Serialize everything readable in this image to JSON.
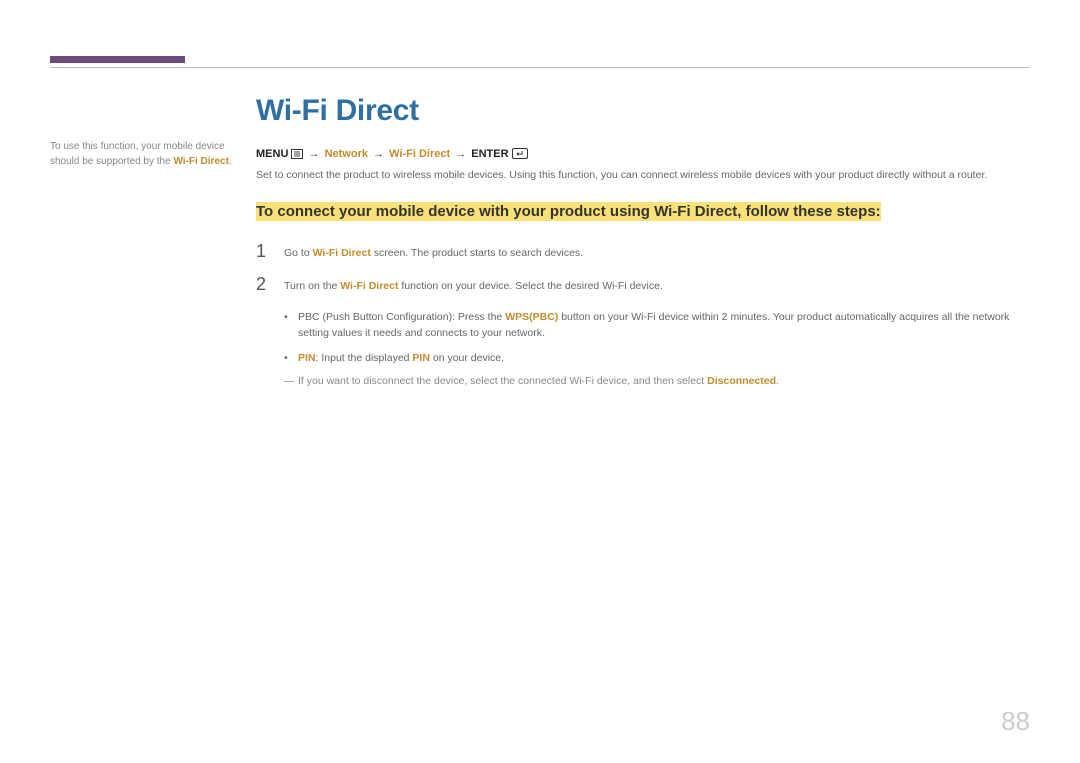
{
  "sidebar": {
    "line1": "To use this function, your mobile device",
    "line2a": "should be supported by the ",
    "line2b": "Wi-Fi Direct",
    "line2c": "."
  },
  "title": "Wi-Fi Direct",
  "nav": {
    "menu": "MENU",
    "arrow": "→",
    "network": "Network",
    "wifidirect": "Wi-Fi Direct",
    "enter": "ENTER"
  },
  "intro": "Set to connect the product to wireless mobile devices. Using this function, you can connect wireless mobile devices with your product directly without a router.",
  "heading2": "To connect your mobile device with your product using Wi-Fi Direct, follow these steps:",
  "steps": {
    "s1": {
      "num": "1",
      "a": "Go to ",
      "b": "Wi-Fi Direct",
      "c": " screen. The product starts to search devices."
    },
    "s2": {
      "num": "2",
      "a": "Turn on the ",
      "b": "Wi-Fi Direct",
      "c": " function on your device. Select the desired Wi-Fi device."
    }
  },
  "bullets": {
    "b1": {
      "a": "PBC (Push Button Configuration): Press the ",
      "b": "WPS(PBC)",
      "c": " button on your Wi-Fi device within 2 minutes. Your product automatically acquires all the network setting values it needs and connects to your network."
    },
    "b2": {
      "a": "PIN",
      "b": ": Input the displayed ",
      "c": "PIN",
      "d": " on your device."
    }
  },
  "note": {
    "a": "If you want to disconnect the device, select the connected Wi-Fi device, and then select ",
    "b": "Disconnected",
    "c": "."
  },
  "pageNumber": "88"
}
